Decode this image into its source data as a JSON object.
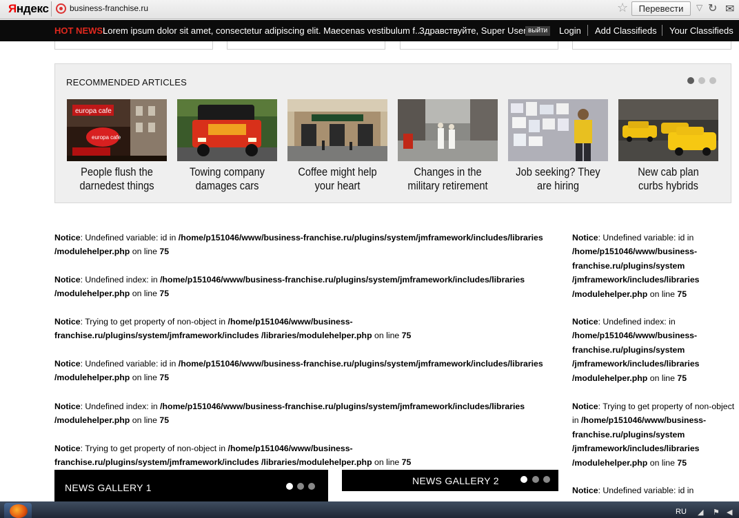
{
  "browser": {
    "logo_text": "Яндекс",
    "address": "business-franchise.ru",
    "translate_label": "Перевести",
    "icons": [
      "bookmark-star-icon",
      "dropdown-icon",
      "reload-icon",
      "mail-icon"
    ]
  },
  "topbar": {
    "hot_label": "HOT NEWS:",
    "hot_text": "Lorem ipsum dolor sit amet, consectetur adipiscing elit. Maecenas vestibulum f...",
    "greeting": "Здравствуйте, Super User",
    "logout_label": "выйти",
    "links": [
      "Login",
      "Add Classifieds",
      "Your Classifieds"
    ]
  },
  "recommended": {
    "title": "RECOMMENDED ARTICLES",
    "page_count": 3,
    "active_page": 1,
    "articles": [
      {
        "title": "People flush the darnedest things",
        "image": "street-cafe-photo"
      },
      {
        "title": "Towing company damages cars",
        "image": "red-truck-photo"
      },
      {
        "title": "Coffee might help your heart",
        "image": "coffee-shop-photo"
      },
      {
        "title": "Changes in the military retirement",
        "image": "sailors-street-photo"
      },
      {
        "title": "Job seeking? They are hiring",
        "image": "job-board-photo"
      },
      {
        "title": "New cab plan curbs hybrids",
        "image": "taxi-cabs-photo"
      }
    ]
  },
  "notices_main": [
    {
      "label": "Notice",
      "msg": ": Undefined variable: id in ",
      "path": "/home/p151046/www/business-franchise.ru/plugins/system/jmframework/includes/libraries /modulehelper.php",
      "on_line": " on line ",
      "line": "75"
    },
    {
      "label": "Notice",
      "msg": ": Undefined index: in ",
      "path": "/home/p151046/www/business-franchise.ru/plugins/system/jmframework/includes/libraries /modulehelper.php",
      "on_line": " on line ",
      "line": "75"
    },
    {
      "label": "Notice",
      "msg": ": Trying to get property of non-object in ",
      "path": "/home/p151046/www/business-franchise.ru/plugins/system/jmframework/includes /libraries/modulehelper.php",
      "on_line": " on line ",
      "line": "75"
    },
    {
      "label": "Notice",
      "msg": ": Undefined variable: id in ",
      "path": "/home/p151046/www/business-franchise.ru/plugins/system/jmframework/includes/libraries /modulehelper.php",
      "on_line": " on line ",
      "line": "75"
    },
    {
      "label": "Notice",
      "msg": ": Undefined index: in ",
      "path": "/home/p151046/www/business-franchise.ru/plugins/system/jmframework/includes/libraries /modulehelper.php",
      "on_line": " on line ",
      "line": "75"
    },
    {
      "label": "Notice",
      "msg": ": Trying to get property of non-object in ",
      "path": "/home/p151046/www/business-franchise.ru/plugins/system/jmframework/includes /libraries/modulehelper.php",
      "on_line": " on line ",
      "line": "75"
    }
  ],
  "notices_side": [
    {
      "label": "Notice",
      "msg": ": Undefined variable: id in ",
      "path": "/home/p151046/www/business- franchise.ru/plugins/system /jmframework/includes/libraries /modulehelper.php",
      "on_line": " on line ",
      "line": "75"
    },
    {
      "label": "Notice",
      "msg": ": Undefined index: in ",
      "path": "/home/p151046/www/business- franchise.ru/plugins/system /jmframework/includes/libraries /modulehelper.php",
      "on_line": " on line ",
      "line": "75"
    },
    {
      "label": "Notice",
      "msg": ": Trying to get property of non-object in ",
      "path": "/home/p151046/www/business- franchise.ru/plugins/system /jmframework/includes/libraries /modulehelper.php",
      "on_line": " on line ",
      "line": "75"
    },
    {
      "label": "Notice",
      "msg": ": Undefined variable: id in ",
      "path": "",
      "on_line": "",
      "line": ""
    }
  ],
  "galleries": [
    {
      "title": "NEWS GALLERY 1",
      "page_count": 3,
      "active_page": 1
    },
    {
      "title": "NEWS GALLERY 2",
      "page_count": 3,
      "active_page": 1
    }
  ],
  "taskbar": {
    "lang": "RU",
    "icons": [
      "start-orb-icon",
      "firefox-icon",
      "network-icon",
      "flag-icon",
      "volume-icon"
    ]
  }
}
